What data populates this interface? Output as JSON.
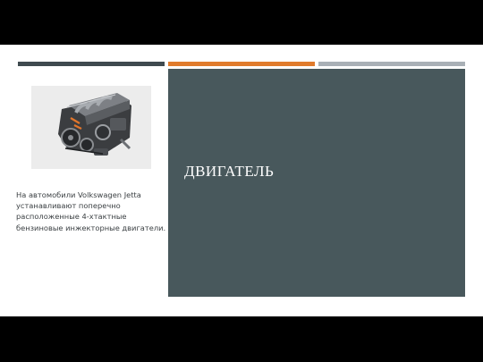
{
  "slide": {
    "title": "ДВИГАТЕЛЬ",
    "body_text": "На автомобили Volkswagen Jetta\nустанавливают поперечно\nрасположенные 4-хтактные\nбензиновые инжекторные  двигатели.",
    "image": {
      "subject": "engine-photo"
    }
  },
  "colors": {
    "background": "#000000",
    "slide_background": "#ffffff",
    "panel": "#48585c",
    "bar_dark": "#3f4a4f",
    "bar_orange": "#e07b2c",
    "bar_gray": "#a9b0b6",
    "title_text": "#ffffff",
    "body_text": "#3a3f42"
  }
}
